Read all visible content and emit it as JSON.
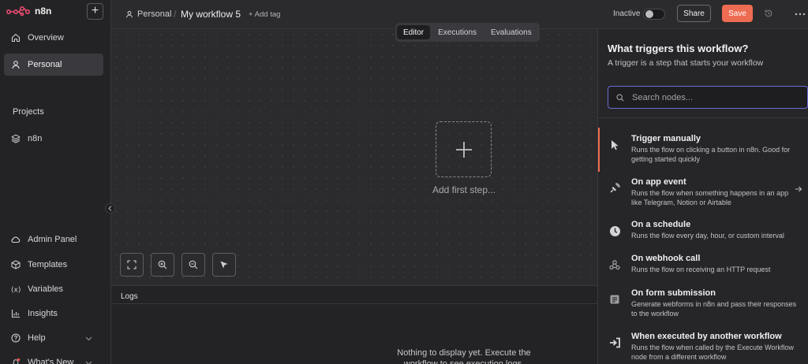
{
  "sidebar": {
    "brand": "n8n",
    "new_label": "+",
    "nav": [
      {
        "label": "Overview",
        "icon": "home-icon"
      },
      {
        "label": "Personal",
        "icon": "user-icon"
      }
    ],
    "projects_title": "Projects",
    "projects": [
      {
        "label": "n8n",
        "icon": "layers-icon"
      }
    ],
    "bottom": [
      {
        "label": "Admin Panel",
        "icon": "cloud-icon"
      },
      {
        "label": "Templates",
        "icon": "box-icon"
      },
      {
        "label": "Variables",
        "icon": "variable-icon"
      },
      {
        "label": "Insights",
        "icon": "chart-icon"
      },
      {
        "label": "Help",
        "icon": "help-icon"
      },
      {
        "label": "What's New",
        "icon": "bell-icon"
      }
    ]
  },
  "header": {
    "project": "Personal",
    "separator": "/",
    "workflow_name": "My workflow 5",
    "add_tag": "+ Add tag",
    "status": "Inactive",
    "share": "Share",
    "save": "Save"
  },
  "canvas": {
    "tabs": [
      "Editor",
      "Executions",
      "Evaluations"
    ],
    "active_tab": "Editor",
    "add_step_label": "Add first step..."
  },
  "logs": {
    "title": "Logs",
    "empty_text": "Nothing to display yet. Execute the workflow to see execution logs."
  },
  "panel": {
    "title": "What triggers this workflow?",
    "subtitle": "A trigger is a step that starts your workflow",
    "search_placeholder": "Search nodes...",
    "triggers": [
      {
        "title": "Trigger manually",
        "desc": "Runs the flow on clicking a button in n8n. Good for getting started quickly",
        "icon": "cursor-icon"
      },
      {
        "title": "On app event",
        "desc": "Runs the flow when something happens in an app like Telegram, Notion or Airtable",
        "icon": "satellite-icon"
      },
      {
        "title": "On a schedule",
        "desc": "Runs the flow every day, hour, or custom interval",
        "icon": "clock-icon"
      },
      {
        "title": "On webhook call",
        "desc": "Runs the flow on receiving an HTTP request",
        "icon": "webhook-icon"
      },
      {
        "title": "On form submission",
        "desc": "Generate webforms in n8n and pass their responses to the workflow",
        "icon": "form-icon"
      },
      {
        "title": "When executed by another workflow",
        "desc": "Runs the flow when called by the Execute Workflow node from a different workflow",
        "icon": "sign-in-icon"
      }
    ]
  },
  "colors": {
    "accent": "#ee6c52",
    "focus": "#6b6bd9"
  }
}
